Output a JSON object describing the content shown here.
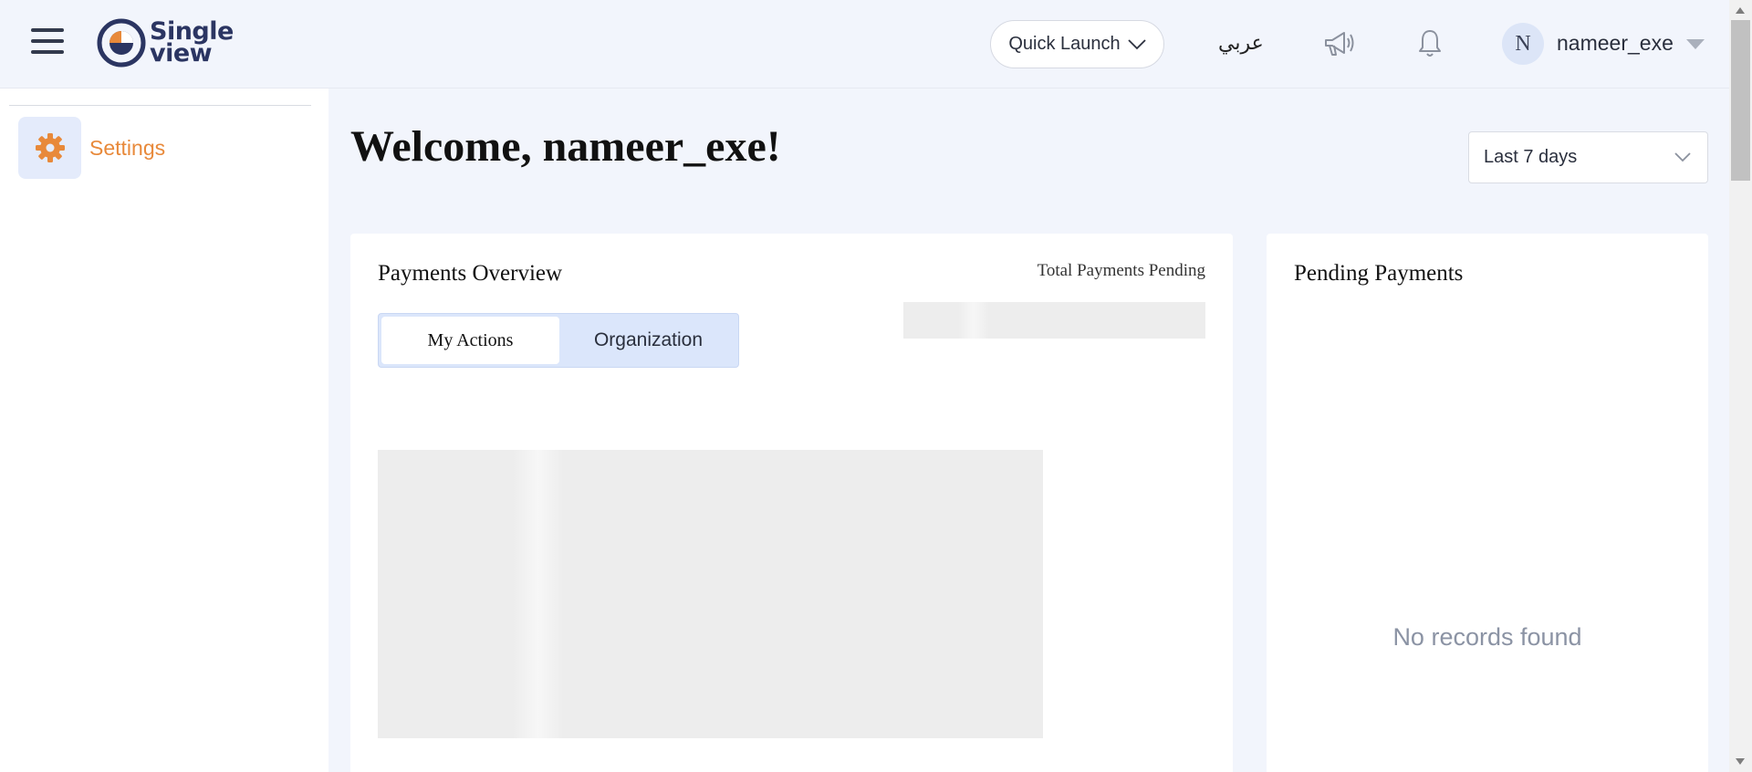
{
  "header": {
    "logo": {
      "line1": "Single",
      "line2": "view"
    },
    "quick_launch_label": "Quick Launch",
    "language_label": "عربي",
    "user": {
      "avatar_initial": "N",
      "name": "nameer_exe"
    }
  },
  "sidebar": {
    "items": [
      {
        "label": "Settings",
        "icon": "gear-icon"
      }
    ]
  },
  "main": {
    "welcome": "Welcome, nameer_exe!",
    "date_filter": {
      "selected": "Last 7 days"
    },
    "payments_overview": {
      "title": "Payments Overview",
      "total_pending_label": "Total Payments Pending",
      "tabs": [
        {
          "label": "My Actions",
          "active": true
        },
        {
          "label": "Organization",
          "active": false
        }
      ]
    },
    "pending_payments": {
      "title": "Pending Payments",
      "empty_text": "No records found"
    }
  },
  "colors": {
    "accent": "#e8893a",
    "brand": "#2b3562",
    "background": "#f2f5fc",
    "toggle_bg": "#dbe6fb"
  }
}
